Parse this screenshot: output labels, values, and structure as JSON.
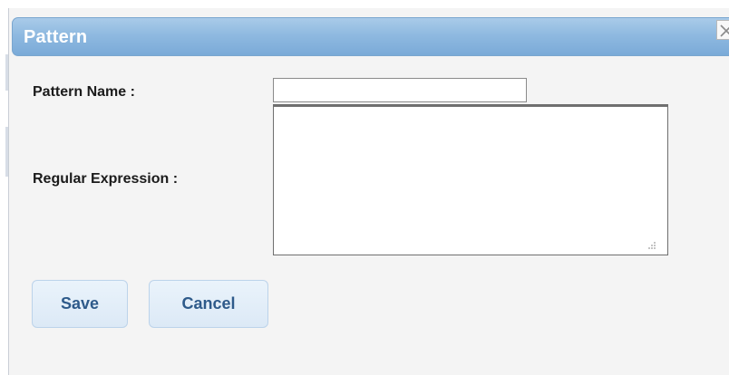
{
  "dialog": {
    "title": "Pattern",
    "close_icon": "close-icon"
  },
  "form": {
    "pattern_name_label": "Pattern Name :",
    "pattern_name_value": "",
    "regex_label": "Regular Expression :",
    "regex_value": ""
  },
  "buttons": {
    "save_label": "Save",
    "cancel_label": "Cancel"
  },
  "colors": {
    "titlebar_start": "#a9cbe9",
    "titlebar_end": "#7aaad8",
    "button_text": "#2e5a8a",
    "dialog_background": "#f4f4f4"
  }
}
